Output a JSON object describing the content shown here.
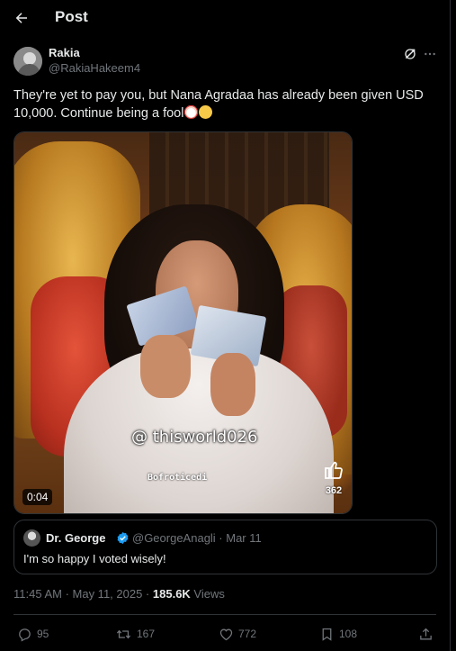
{
  "header": {
    "title": "Post"
  },
  "author": {
    "name": "Rakia",
    "handle": "@RakiaHakeem4"
  },
  "tweet": {
    "text": "They're yet to pay you, but Nana Agradaa has already been given USD 10,000. Continue being a fool"
  },
  "media": {
    "watermark": "@ thisworld026",
    "overlay_text": "Bofroticedi",
    "overlay_like_count": "362",
    "duration": "0:04"
  },
  "quote": {
    "name": "Dr. George",
    "handle_date": "@GeorgeAnagli · Mar 11",
    "text": "I'm so happy I voted wisely!"
  },
  "meta": {
    "time_date": "11:45 AM · May 11, 2025 · ",
    "views_count": "185.6K",
    "views_label": " Views"
  },
  "actions": {
    "replies": "95",
    "reposts": "167",
    "likes": "772",
    "bookmarks": "108"
  },
  "icons": {
    "back": "arrow-left-icon",
    "grok": "grok-icon",
    "more": "more-horizontal-icon",
    "verified": "verified-badge-icon",
    "reply": "reply-icon",
    "repost": "repost-icon",
    "like": "heart-icon",
    "bookmark": "bookmark-icon",
    "share": "share-icon"
  },
  "colors": {
    "background": "#000000",
    "text_primary": "#e7e9ea",
    "text_secondary": "#71767b",
    "border": "#2f3336",
    "verified_blue": "#1d9bf0"
  }
}
